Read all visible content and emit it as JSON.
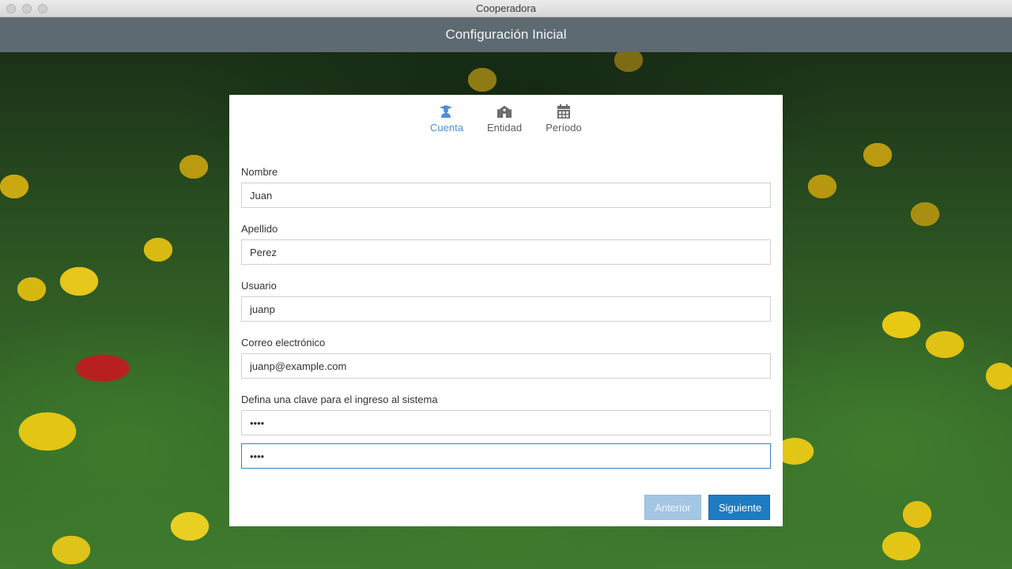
{
  "window": {
    "title": "Cooperadora"
  },
  "header": {
    "title": "Configuración Inicial"
  },
  "steps": [
    {
      "label": "Cuenta",
      "icon": "user-graduate-icon",
      "active": true
    },
    {
      "label": "Entidad",
      "icon": "school-icon",
      "active": false
    },
    {
      "label": "Período",
      "icon": "calendar-icon",
      "active": false
    }
  ],
  "form": {
    "nombre": {
      "label": "Nombre",
      "value": "Juan"
    },
    "apellido": {
      "label": "Apellido",
      "value": "Perez"
    },
    "usuario": {
      "label": "Usuario",
      "value": "juanp"
    },
    "correo": {
      "label": "Correo electrónico",
      "value": "juanp@example.com"
    },
    "clave": {
      "label": "Defina una clave para el ingreso al sistema",
      "value": "1234",
      "confirm_value": "1234"
    }
  },
  "buttons": {
    "prev": "Anterior",
    "next": "Siguiente"
  },
  "colors": {
    "accent": "#1f7cc2",
    "active_step": "#4a90d9",
    "header": "#5e6a71"
  }
}
